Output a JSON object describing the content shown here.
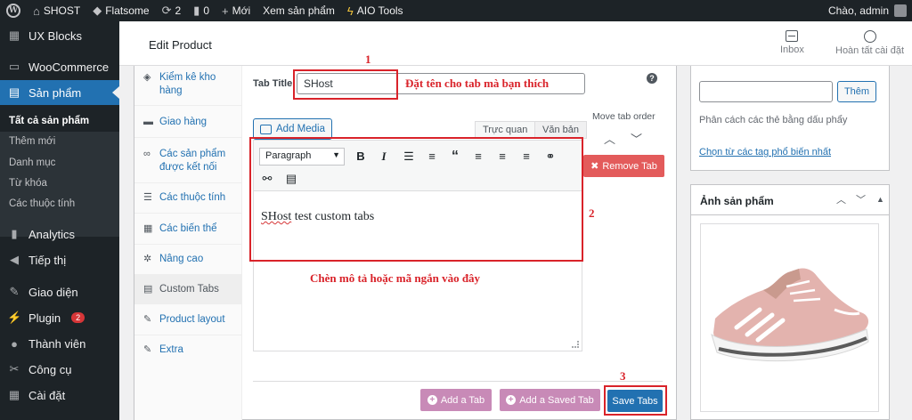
{
  "adminbar": {
    "site": "SHOST",
    "theme": "Flatsome",
    "updates": "2",
    "comments": "0",
    "new": "Mới",
    "view": "Xem sản phẩm",
    "aio": "AIO Tools",
    "greeting": "Chào, admin"
  },
  "sidebar": {
    "items": [
      {
        "label": "UX Blocks",
        "icon": "blocks-icon"
      },
      {
        "label": "WooCommerce",
        "icon": "woo-icon"
      },
      {
        "label": "Sản phẩm",
        "icon": "archive-icon"
      },
      {
        "label": "Analytics",
        "icon": "chart-icon"
      },
      {
        "label": "Tiếp thị",
        "icon": "megaphone-icon"
      },
      {
        "label": "Giao diện",
        "icon": "brush-icon"
      },
      {
        "label": "Plugin",
        "icon": "plugin-icon",
        "badge": "2"
      },
      {
        "label": "Thành viên",
        "icon": "user-icon"
      },
      {
        "label": "Công cụ",
        "icon": "wrench-icon"
      },
      {
        "label": "Cài đặt",
        "icon": "settings-icon"
      }
    ],
    "submenu": [
      "Tất cả sản phẩm",
      "Thêm mới",
      "Danh mục",
      "Từ khóa",
      "Các thuộc tính"
    ]
  },
  "header": {
    "title": "Edit Product",
    "inbox": "Inbox",
    "complete": "Hoàn tất cài đặt"
  },
  "product_tabs": [
    {
      "label": "Kiểm kê kho hàng"
    },
    {
      "label": "Giao hàng"
    },
    {
      "label": "Các sản phẩm được kết nối"
    },
    {
      "label": "Các thuộc tính"
    },
    {
      "label": "Các biến thể"
    },
    {
      "label": "Nâng cao"
    },
    {
      "label": "Custom Tabs"
    },
    {
      "label": "Product layout"
    },
    {
      "label": "Extra"
    }
  ],
  "custom_tab": {
    "title_label": "Tab Title",
    "title_value": "SHost",
    "add_media": "Add Media",
    "visual": "Trực quan",
    "text": "Văn bản",
    "format": "Paragraph",
    "content": "SHost test custom tabs",
    "move_label": "Move tab order",
    "remove": "Remove Tab",
    "add_tab": "Add a Tab",
    "add_saved": "Add a Saved Tab",
    "save": "Save Tabs"
  },
  "tags": {
    "add": "Thêm",
    "hint": "Phân cách các thẻ bằng dấu phẩy",
    "link": "Chọn từ các tag phổ biến nhất"
  },
  "product_image": {
    "title": "Ảnh sản phẩm"
  },
  "annotations": {
    "n1": "1",
    "t1": "Đặt tên cho tab mà bạn thích",
    "n2": "2",
    "t2": "Chèn mô tả hoặc mã ngắn vào đây",
    "n3": "3"
  },
  "colors": {
    "annotation_red": "#d9232a",
    "wp_blue": "#2271b1",
    "remove_red": "#e35b5b",
    "button_purple": "#c88ab7"
  }
}
